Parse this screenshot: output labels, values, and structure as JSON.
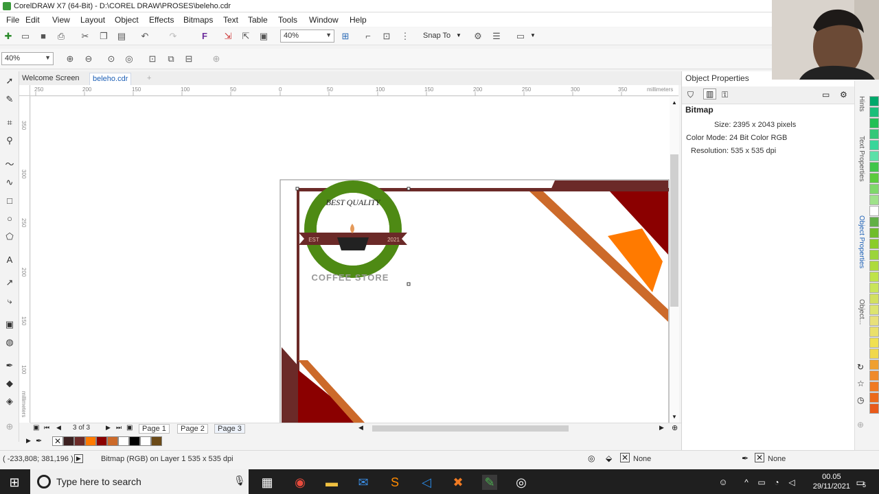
{
  "window": {
    "title": "CorelDRAW X7 (64-Bit) - D:\\COREL DRAW\\PROSES\\beleho.cdr"
  },
  "menu": [
    "File",
    "Edit",
    "View",
    "Layout",
    "Object",
    "Effects",
    "Bitmaps",
    "Text",
    "Table",
    "Tools",
    "Window",
    "Help"
  ],
  "toolbar": {
    "zoom_value": "40%",
    "snap_to": "Snap To",
    "zoom_level_left": "40%"
  },
  "document_tabs": {
    "welcome": "Welcome Screen",
    "active": "beleho.cdr",
    "add": "+"
  },
  "ruler": {
    "h_ticks": [
      "250",
      "200",
      "150",
      "100",
      "50",
      "0",
      "50",
      "100",
      "150",
      "200",
      "250",
      "300",
      "350"
    ],
    "h_unit": "millimeters",
    "v_ticks": [
      "350",
      "300",
      "250",
      "200",
      "150",
      "100"
    ],
    "v_unit": "millimeters"
  },
  "artwork": {
    "badge_text_top": "BEST QUALITY",
    "badge_left": "EST",
    "badge_right": "2021",
    "store_text": "COFFEE STORE"
  },
  "pages": {
    "counter": "3 of 3",
    "tabs": [
      "Page 1",
      "Page 2",
      "Page 3"
    ]
  },
  "status": {
    "coords": "( -233,808; 381,196 )",
    "info": "Bitmap (RGB) on Layer 1 535 x 535 dpi",
    "fill": "None",
    "outline": "None"
  },
  "properties": {
    "panel_title": "Object Properties",
    "section": "Bitmap",
    "size": "Size: 2395 x 2043 pixels",
    "color_mode": "Color Mode: 24 Bit Color RGB",
    "resolution": "Resolution: 535 x 535 dpi"
  },
  "dockers": [
    "Hints",
    "Text Properties",
    "Object Properties",
    "Object..."
  ],
  "taskbar": {
    "search_placeholder": "Type here to search",
    "time": "00.05",
    "date": "29/11/2021",
    "notifications": "5"
  },
  "colors": {
    "dark_red": "#8b0000",
    "maroon_frame": "#6b2a28",
    "orange": "#ff7a00",
    "burnt_orange": "#cc6a2a",
    "badge_green": "#4e8a14"
  }
}
